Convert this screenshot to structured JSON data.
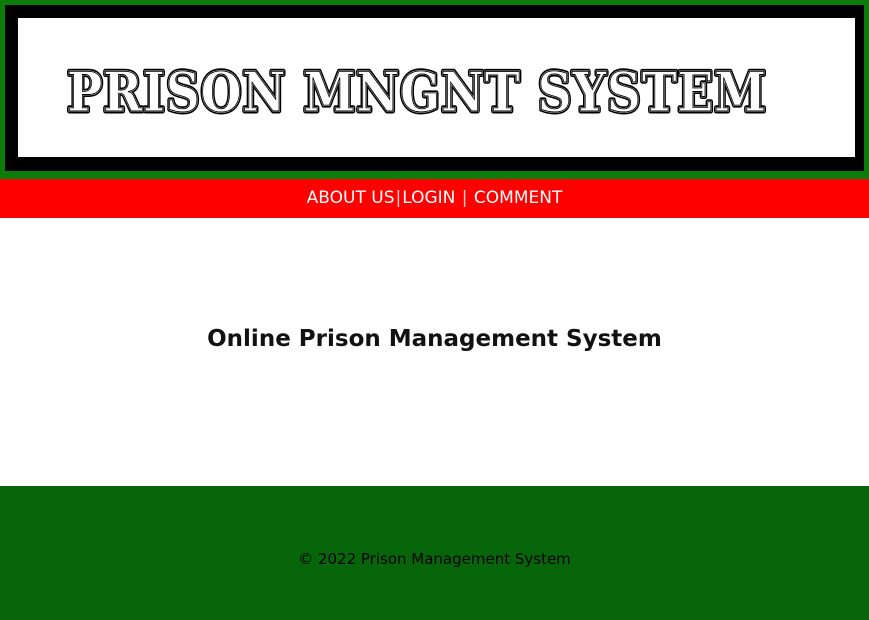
{
  "header": {
    "logo_text": "PRISON MNGNT SYSTEM"
  },
  "nav": {
    "items": [
      {
        "label": "ABOUT US"
      },
      {
        "label": "LOGIN"
      },
      {
        "label": "COMMENT"
      }
    ],
    "separator": "|"
  },
  "main": {
    "heading": "Online Prison Management System"
  },
  "footer": {
    "text": "© 2022 Prison Management System"
  },
  "colors": {
    "header_green": "#0b7d0b",
    "header_frame": "#000000",
    "nav_bar": "#ff0000",
    "footer_green": "#07660a",
    "nav_text": "#ffffff"
  }
}
